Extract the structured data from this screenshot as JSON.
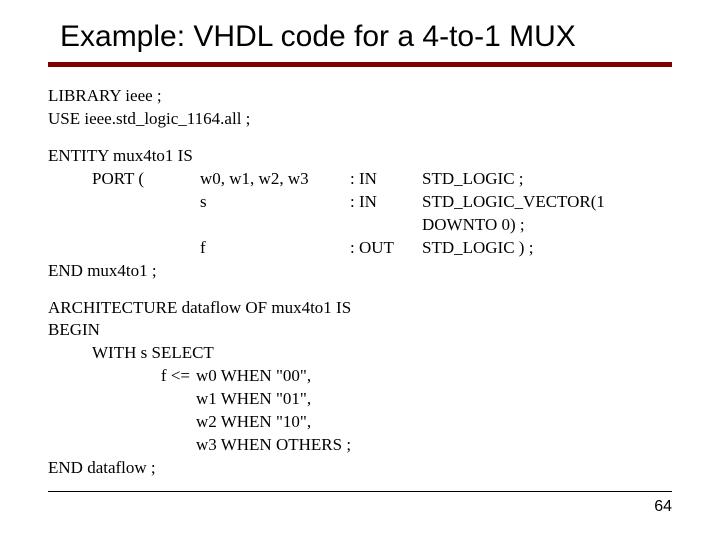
{
  "title": "Example: VHDL code for a 4-to-1 MUX",
  "lib1": "LIBRARY ieee ;",
  "lib2": "USE ieee.std_logic_1164.all ;",
  "ent1": "ENTITY mux4to1 IS",
  "port_lead": "PORT (",
  "p1_sig": "w0, w1, w2, w3",
  "p1_dir": ": IN",
  "p1_type": "STD_LOGIC ;",
  "p2_sig": "s",
  "p2_dir": ": IN",
  "p2_type": "STD_LOGIC_VECTOR(1 DOWNTO 0) ;",
  "p3_sig": "f",
  "p3_dir": ": OUT",
  "p3_type": "STD_LOGIC ) ;",
  "ent_end": "END mux4to1 ;",
  "arch1": "ARCHITECTURE dataflow OF mux4to1 IS",
  "arch2": "BEGIN",
  "arch3": "WITH s SELECT",
  "w0_lead": "f <=",
  "w0": "w0 WHEN \"00\",",
  "w1": "w1 WHEN \"01\",",
  "w2": "w2 WHEN \"10\",",
  "w3": "w3 WHEN OTHERS ;",
  "arch_end": "END dataflow ;",
  "page": "64"
}
